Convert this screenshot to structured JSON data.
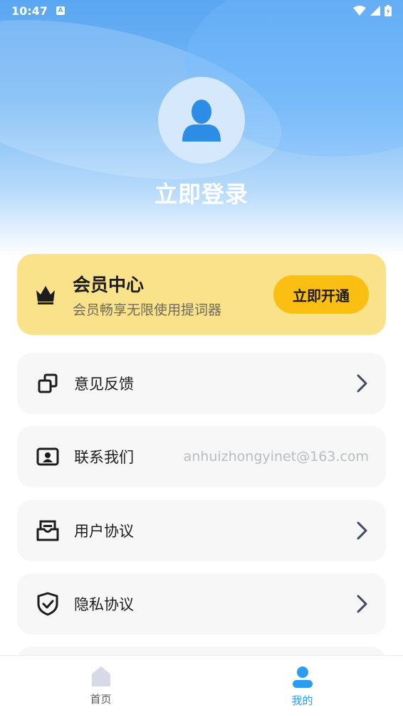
{
  "status_bar": {
    "time": "10:47",
    "notification_letter": "A"
  },
  "profile": {
    "login_label": "立即登录"
  },
  "vip": {
    "title": "会员中心",
    "subtitle": "会员畅享无限使用提词器",
    "button_label": "立即开通"
  },
  "menu": [
    {
      "label": "意见反馈",
      "icon": "copy-icon",
      "has_chevron": true
    },
    {
      "label": "联系我们",
      "icon": "contact-card-icon",
      "value": "anhuizhongyinet@163.com"
    },
    {
      "label": "用户协议",
      "icon": "document-tray-icon",
      "has_chevron": true
    },
    {
      "label": "隐私协议",
      "icon": "shield-check-icon",
      "has_chevron": true
    }
  ],
  "tabs": [
    {
      "label": "首页",
      "icon": "home-icon",
      "active": false
    },
    {
      "label": "我的",
      "icon": "user-icon",
      "active": true
    }
  ],
  "colors": {
    "accent": "#2d9cf0",
    "vip_card": "#f9e28a",
    "vip_button": "#fbbf14",
    "menu_bg": "#f7f7f8"
  }
}
